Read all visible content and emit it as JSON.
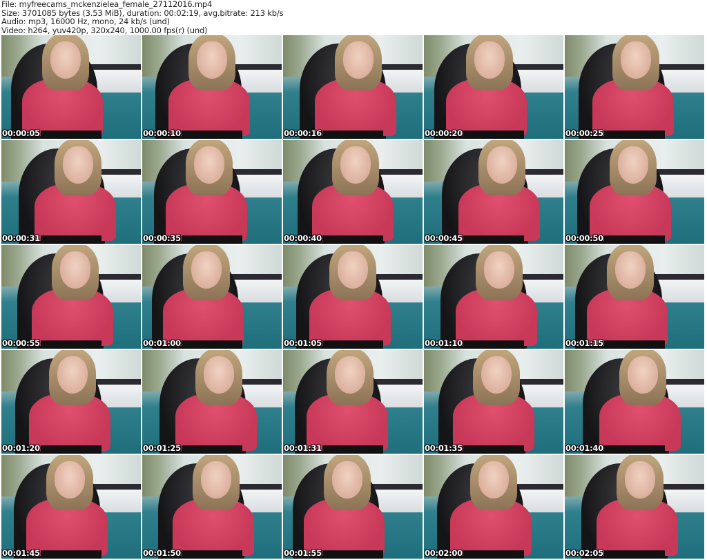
{
  "header": {
    "file": "File: myfreecams_mckenzielea_female_27112016.mp4",
    "size": "Size: 3701085 bytes (3.53 MiB), duration: 00:02:19, avg.bitrate: 213 kb/s",
    "audio": "Audio: mp3, 16000 Hz, mono, 24 kb/s (und)",
    "video": "Video: h264, yuv420p, 320x240, 1000.00 fps(r) (und)"
  },
  "thumbnails": [
    {
      "time": "00:00:05"
    },
    {
      "time": "00:00:10"
    },
    {
      "time": "00:00:16"
    },
    {
      "time": "00:00:20"
    },
    {
      "time": "00:00:25"
    },
    {
      "time": "00:00:31"
    },
    {
      "time": "00:00:35"
    },
    {
      "time": "00:00:40"
    },
    {
      "time": "00:00:45"
    },
    {
      "time": "00:00:50"
    },
    {
      "time": "00:00:55"
    },
    {
      "time": "00:01:00"
    },
    {
      "time": "00:01:05"
    },
    {
      "time": "00:01:10"
    },
    {
      "time": "00:01:15"
    },
    {
      "time": "00:01:20"
    },
    {
      "time": "00:01:25"
    },
    {
      "time": "00:01:31"
    },
    {
      "time": "00:01:35"
    },
    {
      "time": "00:01:40"
    },
    {
      "time": "00:01:45"
    },
    {
      "time": "00:01:50"
    },
    {
      "time": "00:01:55"
    },
    {
      "time": "00:02:00"
    },
    {
      "time": "00:02:05"
    }
  ]
}
